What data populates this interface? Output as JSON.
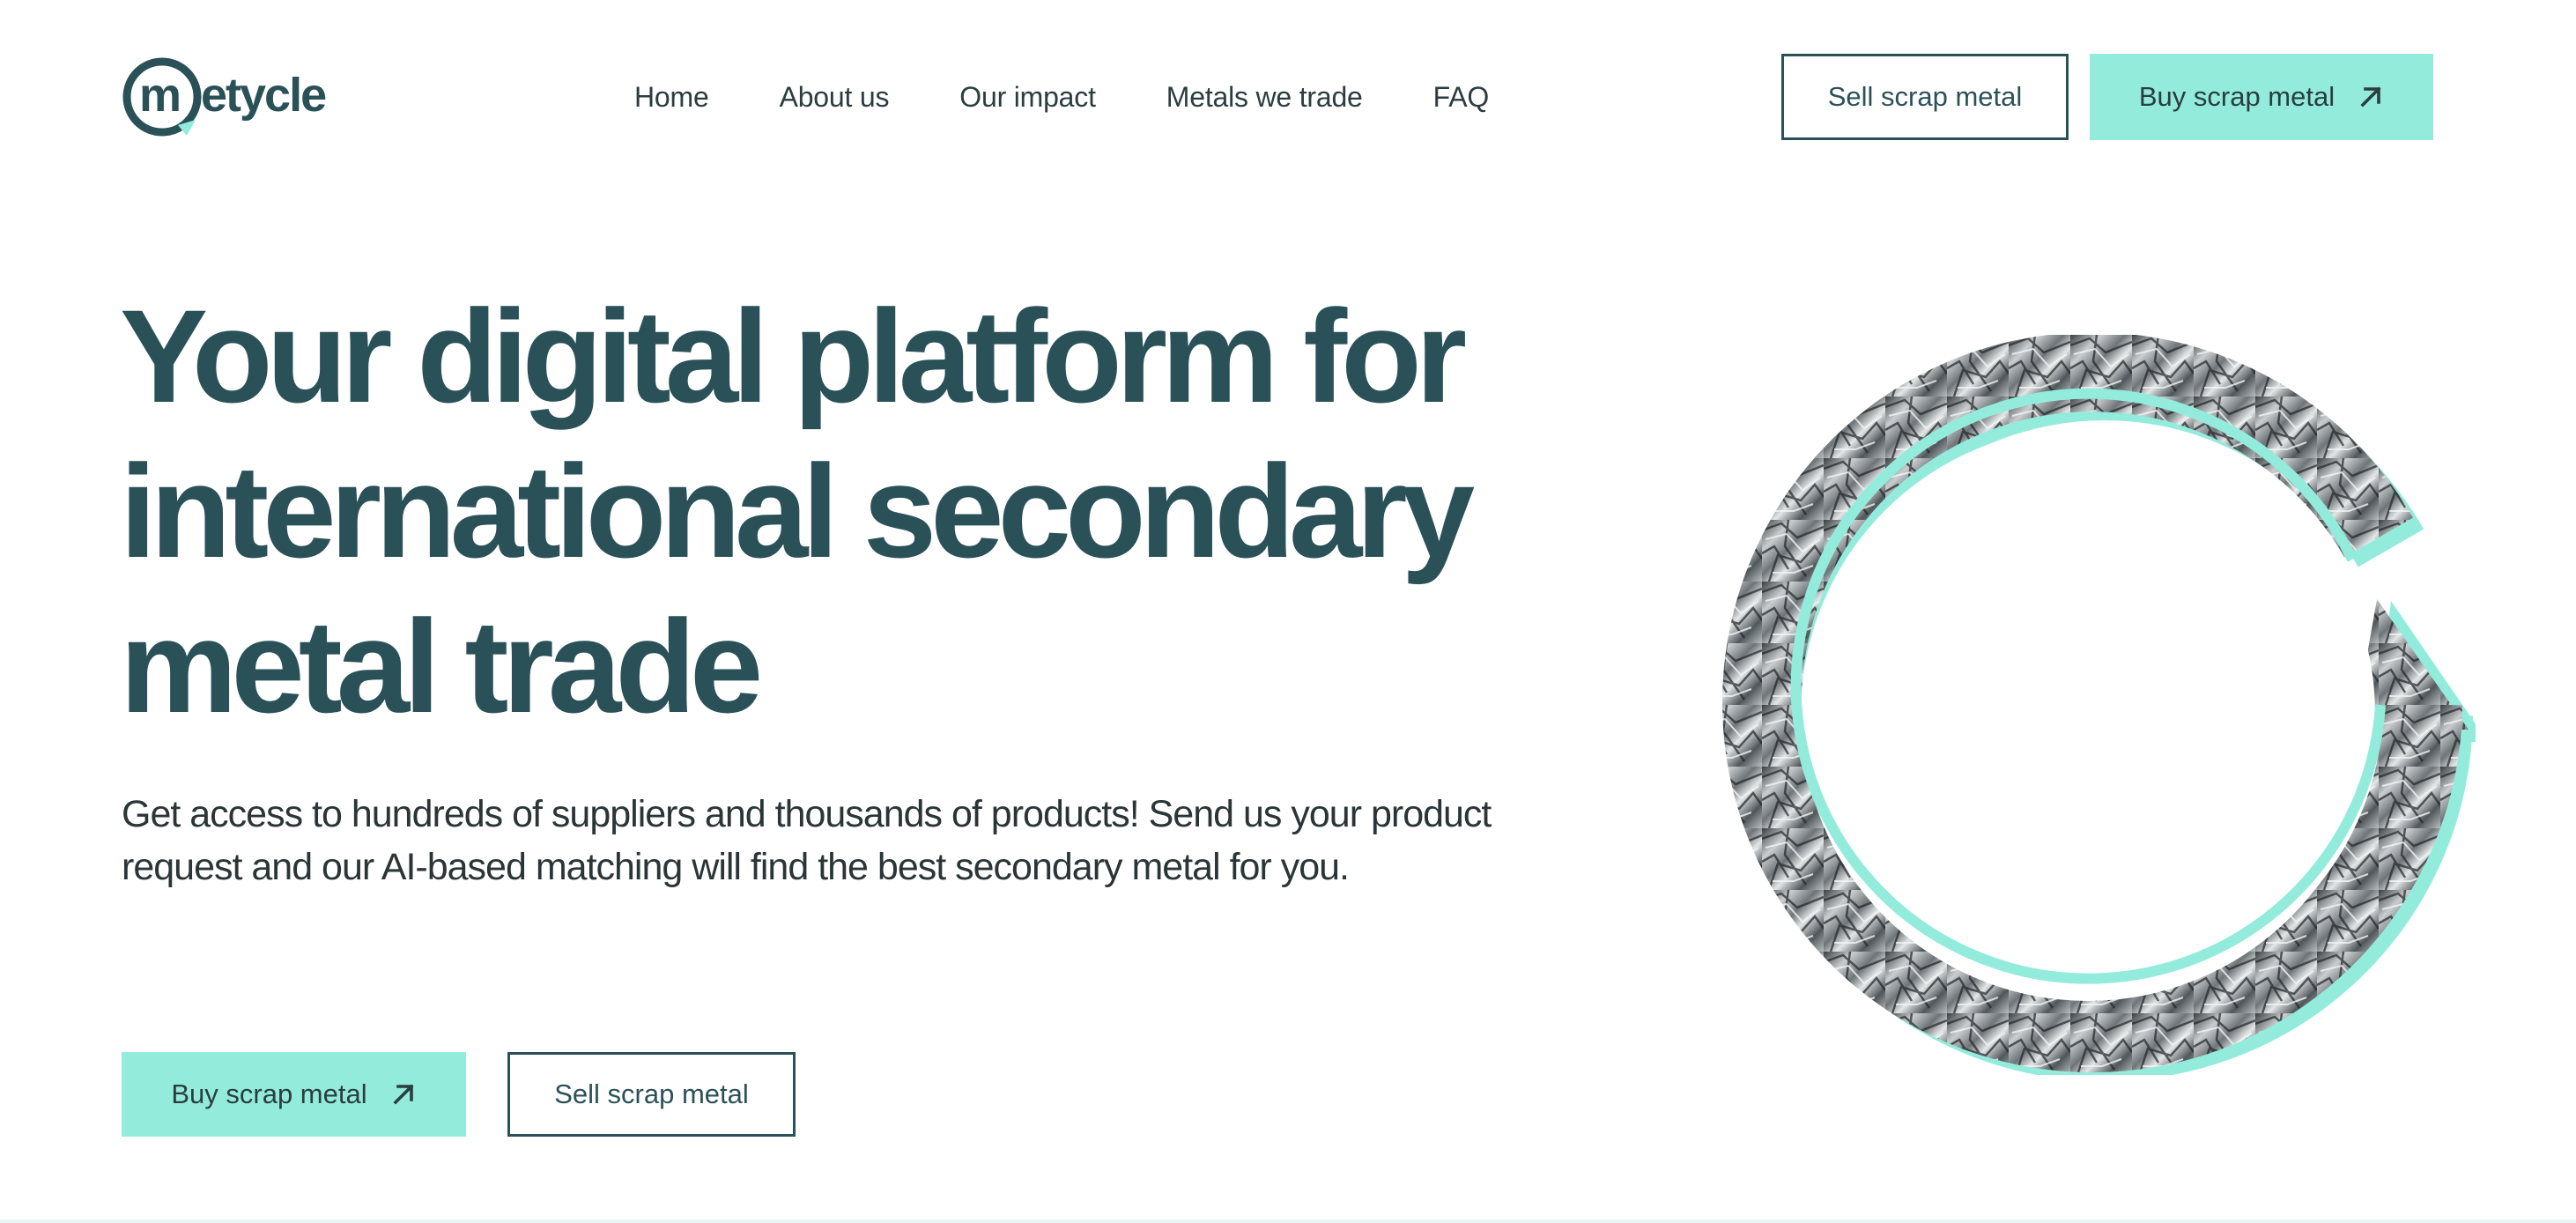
{
  "brand": {
    "logo_text": "metycle",
    "colors": {
      "primary": "#2b5158",
      "accent": "#93ecdb",
      "text": "#2b3538"
    }
  },
  "nav": {
    "items": [
      {
        "label": "Home"
      },
      {
        "label": "About us"
      },
      {
        "label": "Our impact"
      },
      {
        "label": "Metals we trade"
      },
      {
        "label": "FAQ"
      }
    ]
  },
  "header_actions": {
    "sell_label": "Sell scrap metal",
    "buy_label": "Buy scrap metal",
    "buy_icon": "arrow-up-right-icon"
  },
  "hero": {
    "title_lines": [
      "Your digital platform for",
      "international secondary",
      "metal trade"
    ],
    "subtitle": "Get access to hundreds of suppliers and thousands of products! Send us your product request and our AI-based matching will find the best secondary metal for you.",
    "buy_label": "Buy scrap metal",
    "sell_label": "Sell scrap metal",
    "buy_icon": "arrow-up-right-icon",
    "graphic": "recycle-arrow-scrap-metal-image"
  }
}
